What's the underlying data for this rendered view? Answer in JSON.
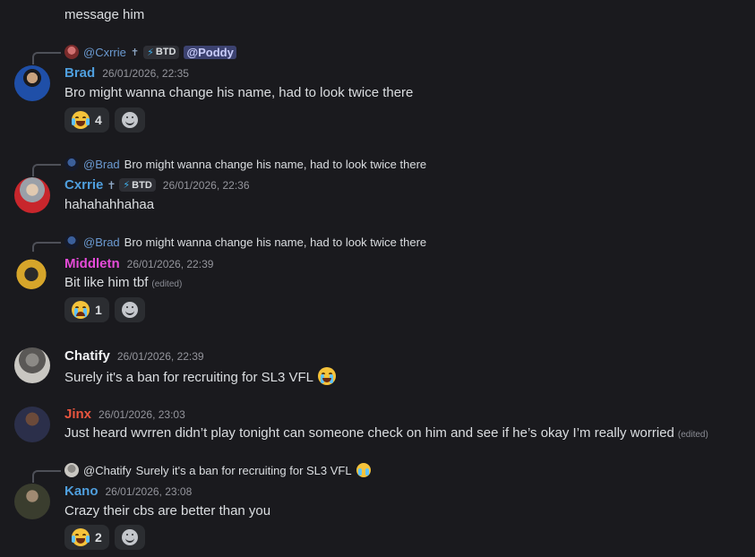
{
  "top_message": {
    "text": "message him"
  },
  "messages": [
    {
      "reply": {
        "who": "@Cxrrie",
        "badge": "BTD",
        "mention": "@Poddy"
      },
      "username": "Brad",
      "username_color": "#4f9fde",
      "timestamp": "26/01/2026, 22:35",
      "text": "Bro might wanna change his name, had to look twice there",
      "reaction": {
        "emoji": "joy",
        "count": "4"
      }
    },
    {
      "reply": {
        "who": "@Brad",
        "text": "Bro might wanna change his name, had to look twice there"
      },
      "username": "Cxrrie",
      "username_color": "#4f9fde",
      "badge": "BTD",
      "timestamp": "26/01/2026, 22:36",
      "text": "hahahahhahaa"
    },
    {
      "reply": {
        "who": "@Brad",
        "text": "Bro might wanna change his name, had to look twice there"
      },
      "username": "Middletn",
      "username_color": "#e64bd8",
      "timestamp": "26/01/2026, 22:39",
      "text": "Bit like him tbf",
      "edited": "(edited)",
      "reaction": {
        "emoji": "sob",
        "count": "1"
      }
    },
    {
      "username": "Chatify",
      "username_color": "#f2f3f5",
      "timestamp": "26/01/2026, 22:39",
      "text": "Surely it's a ban for recruiting for SL3 VFL"
    },
    {
      "username": "Jinx",
      "username_color": "#e8553f",
      "timestamp": "26/01/2026, 23:03",
      "text": "Just heard wvrren didn’t play tonight can someone check on him and see if he’s okay I’m really worried",
      "edited": "(edited)"
    },
    {
      "reply": {
        "who": "@Chatify",
        "text": "Surely it's a ban for recruiting for SL3 VFL"
      },
      "username": "Kano",
      "username_color": "#4f9fde",
      "timestamp": "26/01/2026, 23:08",
      "text": "Crazy their cbs are better than you",
      "reaction": {
        "emoji": "joy",
        "count": "2"
      }
    }
  ],
  "colors": {
    "background": "#1a1a1e",
    "reaction_bg": "#2b2d31",
    "mention_bg": "#3c4270"
  }
}
